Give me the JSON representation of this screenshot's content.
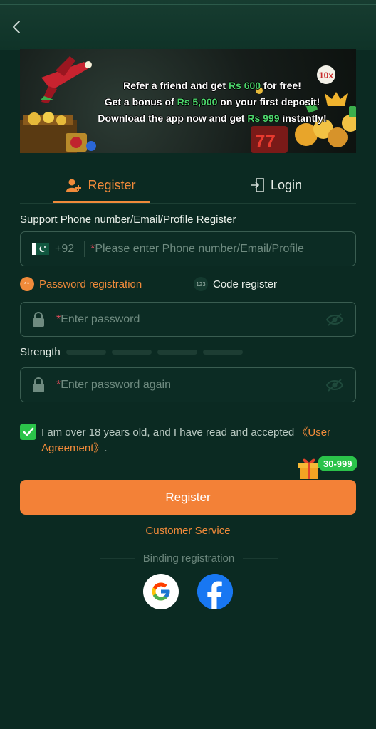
{
  "banner": {
    "line1_pre": "Refer a friend and get ",
    "line1_hl": "Rs 600",
    "line1_post": " for free!",
    "line2_pre": "Get a bonus of ",
    "line2_hl": "Rs 5,000",
    "line2_post": " on your first deposit!",
    "line3_pre": "Download the app now and get ",
    "line3_hl": "Rs 999",
    "line3_post": " instantly!"
  },
  "tabs": {
    "register": "Register",
    "login": "Login"
  },
  "form": {
    "support_label": "Support Phone number/Email/Profile Register",
    "country_code": "+92",
    "star": "*",
    "phone_placeholder": "Please enter Phone number/Email/Profile",
    "mode_password": "Password registration",
    "mode_password_dots": "**",
    "mode_code": "Code register",
    "mode_code_dots": "123",
    "password_placeholder": "Enter password",
    "strength_label": "Strength",
    "password_again_placeholder": "Enter password again",
    "agree_text": "I am over 18 years old, and I have read and accepted ",
    "agree_link": "《User Agreement》",
    "agree_end": ".",
    "agree_checked": true
  },
  "bonus_badge": "30-999",
  "register_button": "Register",
  "customer_service": "Customer Service",
  "binding_label": "Binding registration",
  "colors": {
    "accent": "#f38137",
    "background": "#0b2a22",
    "check": "#2bc34a",
    "facebook": "#1877f2"
  },
  "icons": [
    "back-arrow-icon",
    "register-user-icon",
    "login-door-icon",
    "pakistan-flag-icon",
    "lock-icon",
    "eye-off-icon",
    "checkbox-check-icon",
    "gift-icon",
    "google-icon",
    "facebook-icon"
  ]
}
